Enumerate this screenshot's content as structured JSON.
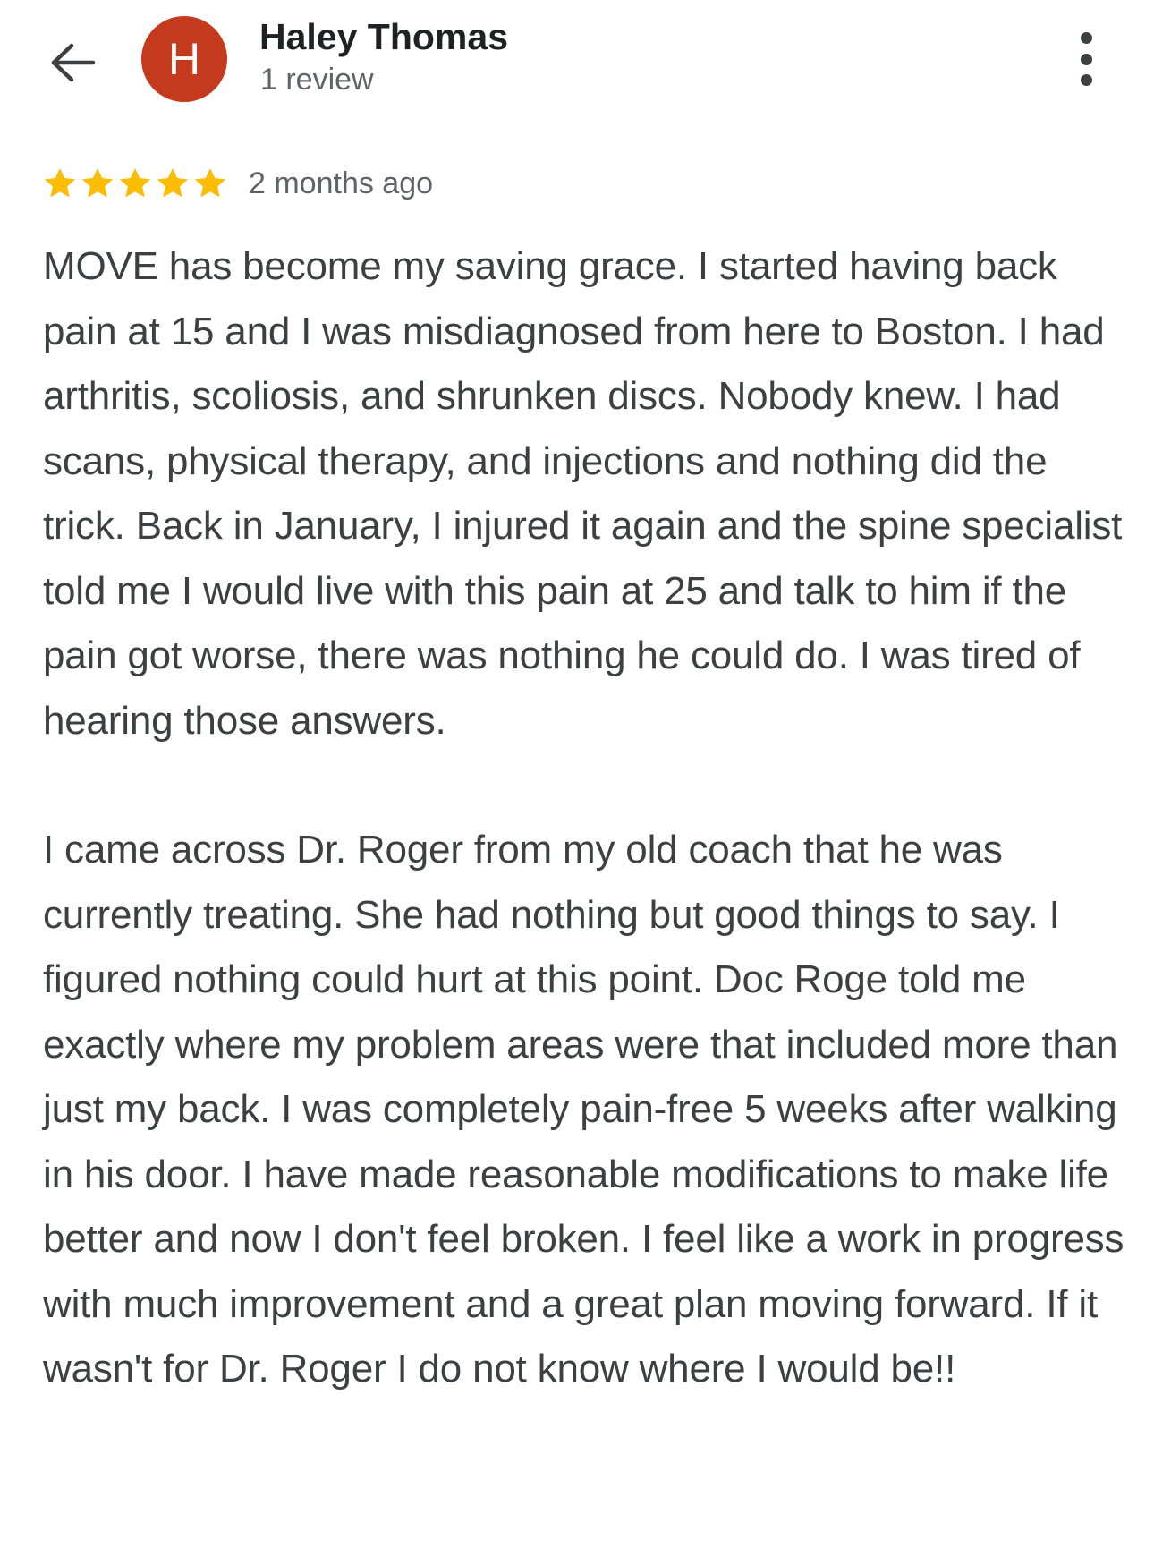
{
  "header": {
    "back_icon": "arrow-left-icon",
    "avatar_letter": "H",
    "avatar_color": "#c5391d",
    "name": "Haley Thomas",
    "review_count": "1 review",
    "more_icon": "more-vert-icon"
  },
  "review": {
    "rating": 5,
    "rating_max": 5,
    "star_color": "#fbbc04",
    "time": "2 months ago",
    "paragraphs": [
      "MOVE has become my saving grace. I started having back pain at 15 and I was misdiagnosed from here to Boston. I had arthritis, scoliosis, and shrunken discs. Nobody knew. I had scans, physical therapy, and injections and nothing did the trick. Back in January, I injured it again and the spine specialist told me I would live with this pain at 25 and talk to him if the pain got worse, there was nothing he could do. I was tired of hearing those answers.",
      "I came across Dr. Roger from my old coach that he was currently treating. She had nothing but good things to say. I figured nothing could hurt at this point. Doc Roge told me exactly where my problem areas were that included more than just my back. I was completely pain-free 5 weeks after walking in his door. I have made reasonable modifications to make life better and now I don't feel broken. I feel like a work in progress with much improvement and a great plan moving forward. If it wasn't for Dr. Roger I do not know where I would be!!"
    ]
  }
}
